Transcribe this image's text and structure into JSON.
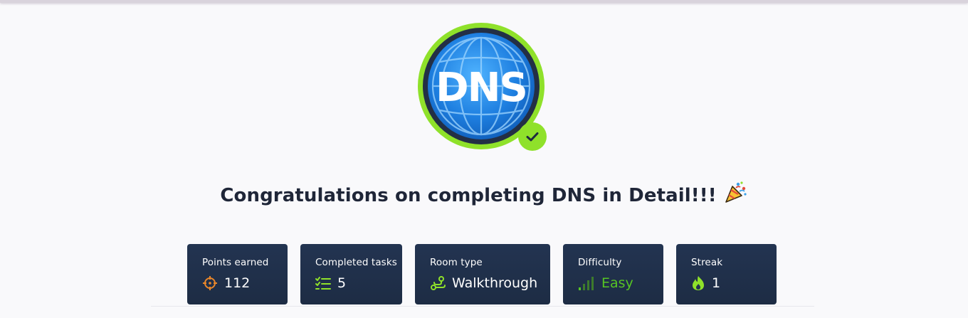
{
  "room": {
    "badge_text": "DNS",
    "completed": true,
    "title": "Congratulations on completing DNS in Detail!!!"
  },
  "stats": [
    {
      "label": "Points earned",
      "value": "112",
      "icon": "crosshair-icon"
    },
    {
      "label": "Completed tasks",
      "value": "5",
      "icon": "checklist-icon"
    },
    {
      "label": "Room type",
      "value": "Walkthrough",
      "icon": "route-icon"
    },
    {
      "label": "Difficulty",
      "value": "Easy",
      "icon": "signal-bars-icon"
    },
    {
      "label": "Streak",
      "value": "1",
      "icon": "flame-icon"
    }
  ],
  "colors": {
    "card_bg": "#233451",
    "accent_green": "#8fe12a",
    "points_orange": "#e8862a",
    "easy_green": "#56c424",
    "title_text": "#1f2638"
  }
}
